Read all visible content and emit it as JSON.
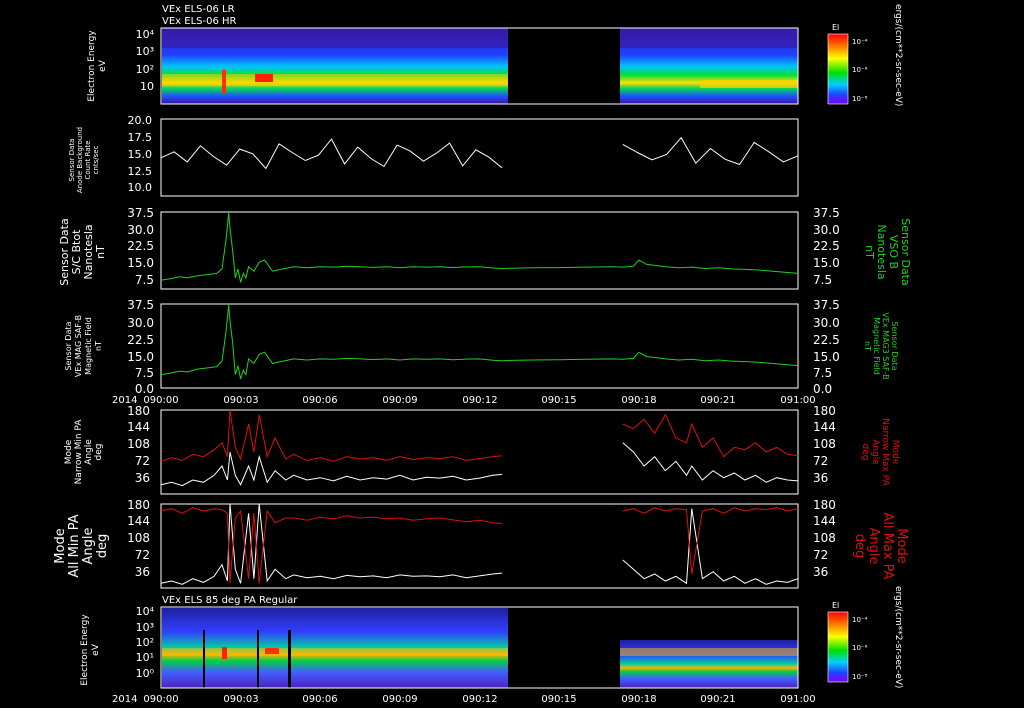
{
  "panel_titles": {
    "p1_line1": "VEx ELS-06 LR",
    "p1_line2": "VEx ELS-06 HR",
    "p7": "VEx ELS 85 deg PA Regular"
  },
  "year_label": "2014",
  "time_ticks": [
    "090:00",
    "090:03",
    "090:06",
    "090:09",
    "090:12",
    "090:15",
    "090:18",
    "090:21",
    "091:00"
  ],
  "colorbar": {
    "label": "El",
    "ticks": [
      "10⁻⁴",
      "10⁻⁶",
      "10⁻⁸"
    ],
    "unit": "ergs/(cm**2-sr-sec-eV)"
  },
  "colors": {
    "white": "#ffffff",
    "green": "#1fd21f",
    "red": "#dd1010",
    "axis": "#ffffff"
  },
  "chart_data": [
    {
      "type": "heatmap",
      "panel": "p1",
      "ylabel": [
        "Electron Energy",
        "eV"
      ],
      "ytick_labels": [
        "10⁴",
        "10³",
        "10²",
        "10"
      ],
      "yscale": "log",
      "ylim": [
        1,
        20000
      ],
      "gap": [
        "090:12:51",
        "090:17:24"
      ]
    },
    {
      "type": "line",
      "panel": "p2",
      "ylabel": [
        "Sensor Data",
        "Anode Background",
        "Count Rate",
        "cnts/sec"
      ],
      "ytick_labels": [
        "20.0",
        "17.5",
        "15.0",
        "12.5",
        "10.0"
      ],
      "ylim": [
        8.5,
        20
      ],
      "series": [
        {
          "color": "white",
          "values": [
            14.2,
            15.1,
            13.6,
            16.0,
            14.4,
            13.1,
            15.5,
            14.8,
            12.6,
            16.3,
            15.0,
            13.8,
            14.6,
            17.0,
            13.3,
            15.8,
            14.1,
            12.9,
            16.1,
            15.2,
            13.7,
            14.9,
            16.4,
            13.0,
            15.4,
            14.3,
            12.7,
            16.2,
            15.0,
            13.9,
            14.7,
            17.2,
            13.4,
            15.6,
            14.0,
            13.2,
            16.5,
            15.1,
            13.6,
            14.5
          ]
        }
      ],
      "gap": [
        "090:12:51",
        "090:17:24"
      ]
    },
    {
      "type": "line",
      "panel": "p3",
      "ylabel": [
        "Sensor Data",
        "S/C Btot",
        "Nanotesla",
        "nT"
      ],
      "ylabel_right": [
        "Sensor Data",
        "VSO B",
        "Nanotesla",
        "nT"
      ],
      "ytick_labels": [
        "37.5",
        "30.0",
        "22.5",
        "15.0",
        "7.5"
      ],
      "ylim": [
        3,
        37.5
      ],
      "series": [
        {
          "color": "green",
          "x": [
            0,
            0.3,
            0.7,
            1.0,
            1.4,
            1.8,
            2.1,
            2.3,
            2.45,
            2.55,
            2.6,
            2.7,
            2.8,
            2.9,
            3.0,
            3.1,
            3.2,
            3.3,
            3.5,
            3.7,
            3.9,
            4.2,
            4.6,
            5.0,
            5.5,
            6.0,
            6.5,
            7.0,
            7.5,
            8.0,
            8.5,
            9.0,
            9.5,
            10.0,
            10.5,
            11.0,
            11.5,
            12.0,
            12.5,
            12.85,
            13.2,
            14.0,
            15.0,
            16.0,
            17.0,
            17.4,
            17.8,
            18.0,
            18.3,
            18.7,
            19.0,
            19.5,
            20.0,
            20.5,
            21.0,
            21.5,
            22.0,
            22.5,
            23.0,
            23.5,
            24.0
          ],
          "values": [
            7,
            7.5,
            8.5,
            8,
            9,
            9.5,
            10,
            12,
            25,
            37,
            30,
            20,
            8,
            12,
            6,
            10,
            8,
            13,
            11,
            15,
            16,
            11,
            12,
            13,
            12.5,
            13,
            12.8,
            13.2,
            13,
            12.7,
            13,
            12.5,
            13,
            12.8,
            13,
            12.6,
            12.9,
            13,
            12.4,
            12.2,
            12.3,
            12.5,
            12.6,
            12.8,
            13,
            12.8,
            13.2,
            16,
            14,
            13.5,
            13,
            12.5,
            12.8,
            12.2,
            12.5,
            12,
            11.8,
            11.5,
            11,
            10.5,
            10
          ]
        }
      ]
    },
    {
      "type": "line",
      "panel": "p4",
      "ylabel": [
        "Sensor Data",
        "VEx MAG SAF-B",
        "Magnetic Field",
        "nT"
      ],
      "ylabel_right": [
        "Sensor Data",
        "VEx MAG3 SAF-B",
        "Magnetic Field",
        "nT"
      ],
      "ytick_labels": [
        "37.5",
        "30.0",
        "22.5",
        "15.0",
        "7.5",
        "0.0"
      ],
      "ylim": [
        0,
        37.5
      ],
      "series": [
        {
          "color": "green",
          "x": [
            0,
            0.3,
            0.7,
            1.0,
            1.4,
            1.8,
            2.1,
            2.3,
            2.45,
            2.55,
            2.6,
            2.7,
            2.8,
            2.9,
            3.0,
            3.1,
            3.2,
            3.3,
            3.5,
            3.7,
            3.9,
            4.2,
            4.6,
            5.0,
            5.5,
            6.0,
            6.5,
            7.0,
            7.5,
            8.0,
            8.5,
            9.0,
            9.5,
            10.0,
            10.5,
            11.0,
            11.5,
            12.0,
            12.5,
            12.85,
            13.2,
            14.0,
            15.0,
            16.0,
            17.0,
            17.4,
            17.8,
            18.0,
            18.3,
            18.7,
            19.0,
            19.5,
            20.0,
            20.5,
            21.0,
            21.5,
            22.0,
            22.5,
            23.0,
            23.5,
            24.0
          ],
          "values": [
            6,
            6.5,
            7.5,
            7.2,
            8.5,
            9,
            9.5,
            12,
            25,
            37,
            30,
            20,
            6,
            10,
            4,
            8,
            6,
            13,
            11,
            15,
            16,
            11,
            12,
            13,
            12.5,
            13,
            12.8,
            13.2,
            13,
            12.7,
            13,
            12.5,
            13,
            12.8,
            13,
            12.6,
            12.9,
            13,
            12.4,
            12.2,
            12.3,
            12.5,
            12.6,
            12.8,
            13,
            12.8,
            13.2,
            16,
            14,
            13.5,
            13,
            12.5,
            12.8,
            12.2,
            12.5,
            12,
            11.8,
            11.5,
            11,
            10.5,
            10
          ]
        }
      ]
    },
    {
      "type": "line",
      "panel": "p5",
      "ylabel": [
        "Mode",
        "Narrow Min PA",
        "Angle",
        "deg"
      ],
      "ylabel_right": [
        "Mode",
        "Narrow Max PA",
        "Angle",
        "deg"
      ],
      "ytick_labels": [
        "180",
        "144",
        "108",
        "72",
        "36"
      ],
      "ylim": [
        0,
        180
      ],
      "series": [
        {
          "name": "min",
          "color": "white",
          "x": [
            0,
            0.4,
            0.8,
            1.2,
            1.6,
            2.0,
            2.3,
            2.5,
            2.6,
            2.8,
            3.0,
            3.3,
            3.5,
            3.7,
            4.0,
            4.3,
            4.7,
            5.0,
            5.5,
            6.0,
            6.5,
            7.0,
            7.5,
            8.0,
            8.5,
            9.0,
            9.5,
            10.0,
            10.5,
            11.0,
            11.5,
            12.0,
            12.5,
            12.85,
            17.4,
            17.8,
            18.2,
            18.6,
            19.0,
            19.4,
            19.8,
            20.0,
            20.4,
            20.8,
            21.2,
            21.6,
            22.0,
            22.4,
            22.8,
            23.2,
            23.6,
            24.0
          ],
          "values": [
            20,
            25,
            18,
            30,
            25,
            40,
            60,
            30,
            90,
            40,
            20,
            60,
            30,
            80,
            25,
            50,
            30,
            40,
            30,
            35,
            28,
            38,
            30,
            35,
            32,
            40,
            30,
            36,
            34,
            38,
            30,
            34,
            40,
            42,
            110,
            90,
            60,
            80,
            50,
            70,
            40,
            60,
            30,
            50,
            35,
            45,
            30,
            40,
            25,
            35,
            30,
            28
          ]
        },
        {
          "name": "max",
          "color": "red",
          "x": [
            0,
            0.4,
            0.8,
            1.2,
            1.6,
            2.0,
            2.3,
            2.5,
            2.6,
            2.8,
            3.0,
            3.3,
            3.5,
            3.7,
            4.0,
            4.3,
            4.7,
            5.0,
            5.5,
            6.0,
            6.5,
            7.0,
            7.5,
            8.0,
            8.5,
            9.0,
            9.5,
            10.0,
            10.5,
            11.0,
            11.5,
            12.0,
            12.5,
            12.85,
            17.4,
            17.8,
            18.2,
            18.6,
            19.0,
            19.4,
            19.8,
            20.0,
            20.4,
            20.8,
            21.2,
            21.6,
            22.0,
            22.4,
            22.8,
            23.2,
            23.6,
            24.0
          ],
          "values": [
            70,
            78,
            72,
            85,
            80,
            95,
            110,
            80,
            180,
            100,
            75,
            150,
            90,
            170,
            80,
            120,
            75,
            85,
            72,
            78,
            70,
            80,
            75,
            78,
            72,
            80,
            74,
            78,
            76,
            80,
            72,
            76,
            80,
            82,
            150,
            140,
            160,
            130,
            170,
            120,
            110,
            150,
            100,
            120,
            80,
            100,
            95,
            110,
            90,
            100,
            85,
            82
          ]
        }
      ],
      "gap": [
        "090:12:51",
        "090:17:24"
      ]
    },
    {
      "type": "line",
      "panel": "p6",
      "ylabel": [
        "Mode",
        "All Min PA",
        "Angle",
        "deg"
      ],
      "ylabel_right": [
        "Mode",
        "All Max PA",
        "Angle",
        "deg"
      ],
      "ytick_labels": [
        "180",
        "144",
        "108",
        "72",
        "36"
      ],
      "ylim": [
        0,
        180
      ],
      "series": [
        {
          "name": "min",
          "color": "white",
          "x": [
            0,
            0.4,
            0.8,
            1.2,
            1.6,
            2.0,
            2.3,
            2.5,
            2.6,
            2.8,
            3.0,
            3.3,
            3.5,
            3.7,
            4.0,
            4.3,
            4.7,
            5.0,
            5.5,
            6.0,
            6.5,
            7.0,
            7.5,
            8.0,
            8.5,
            9.0,
            9.5,
            10.0,
            10.5,
            11.0,
            11.5,
            12.0,
            12.5,
            12.85,
            17.4,
            17.8,
            18.2,
            18.6,
            19.0,
            19.4,
            19.8,
            20.0,
            20.4,
            20.8,
            21.2,
            21.6,
            22.0,
            22.4,
            22.8,
            23.2,
            23.6,
            24.0
          ],
          "values": [
            10,
            15,
            8,
            20,
            12,
            25,
            50,
            15,
            180,
            40,
            10,
            160,
            20,
            180,
            15,
            40,
            20,
            28,
            22,
            25,
            20,
            27,
            24,
            26,
            22,
            28,
            25,
            26,
            24,
            28,
            22,
            26,
            30,
            32,
            60,
            40,
            20,
            30,
            15,
            25,
            10,
            170,
            20,
            35,
            15,
            25,
            10,
            20,
            8,
            15,
            12,
            20
          ]
        },
        {
          "name": "max",
          "color": "red",
          "x": [
            0,
            0.4,
            0.8,
            1.2,
            1.6,
            2.0,
            2.3,
            2.5,
            2.6,
            2.8,
            3.0,
            3.3,
            3.5,
            3.7,
            4.0,
            4.3,
            4.7,
            5.0,
            5.5,
            6.0,
            6.5,
            7.0,
            7.5,
            8.0,
            8.5,
            9.0,
            9.5,
            10.0,
            10.5,
            11.0,
            11.5,
            12.0,
            12.5,
            12.85,
            17.4,
            17.8,
            18.2,
            18.6,
            19.0,
            19.4,
            19.8,
            20.0,
            20.4,
            20.8,
            21.2,
            21.6,
            22.0,
            22.4,
            22.8,
            23.2,
            23.6,
            24.0
          ],
          "values": [
            165,
            170,
            160,
            172,
            165,
            170,
            168,
            160,
            10,
            150,
            165,
            20,
            160,
            10,
            165,
            140,
            150,
            150,
            145,
            152,
            148,
            155,
            150,
            152,
            148,
            150,
            145,
            148,
            150,
            146,
            142,
            145,
            140,
            138,
            165,
            170,
            160,
            172,
            165,
            170,
            168,
            30,
            165,
            170,
            160,
            172,
            165,
            170,
            168,
            172,
            165,
            170
          ]
        }
      ],
      "gap": [
        "090:12:51",
        "090:17:24"
      ]
    },
    {
      "type": "heatmap",
      "panel": "p7",
      "ylabel": [
        "Electron Energy",
        "eV"
      ],
      "ytick_labels": [
        "10⁴",
        "10³",
        "10²",
        "10¹",
        "10⁰"
      ],
      "yscale": "log",
      "ylim": [
        1,
        20000
      ],
      "gap": [
        "090:12:51",
        "090:17:24"
      ]
    }
  ]
}
